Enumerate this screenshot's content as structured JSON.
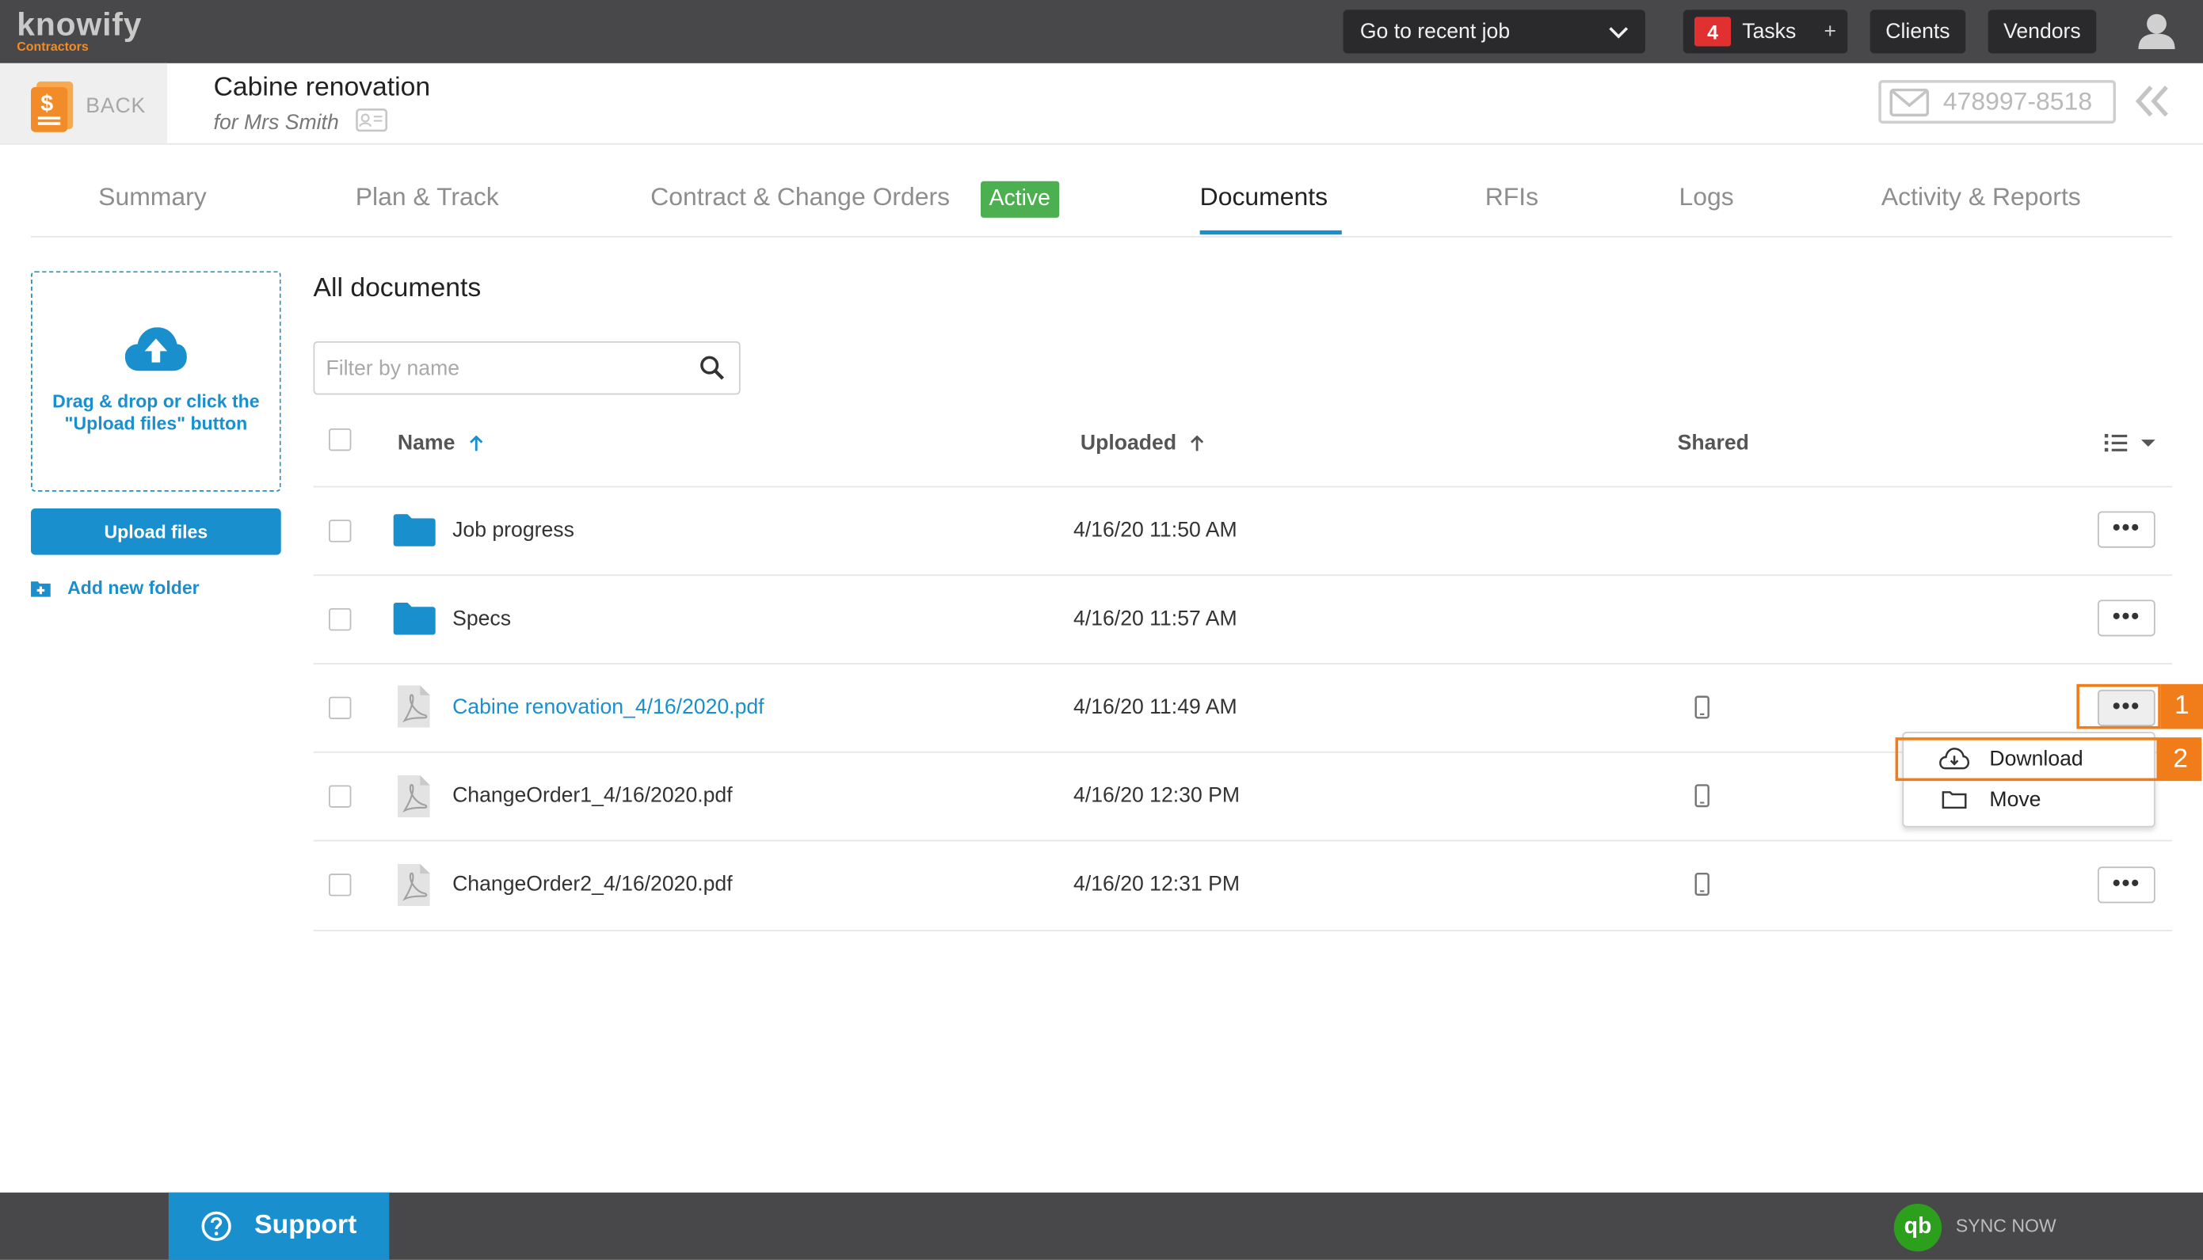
{
  "brand": {
    "name": "knowify",
    "sub": "Contractors"
  },
  "topbar": {
    "recent_job": "Go to recent job",
    "tasks_count": "4",
    "tasks_label": "Tasks",
    "tasks_plus": "+",
    "clients": "Clients",
    "vendors": "Vendors"
  },
  "job": {
    "back": "BACK",
    "title": "Cabine renovation",
    "subtitle": "for Mrs Smith",
    "phone": "478997-8518"
  },
  "tabs": [
    {
      "label": "Summary"
    },
    {
      "label": "Plan & Track"
    },
    {
      "label": "Contract & Change Orders",
      "badge": "Active"
    },
    {
      "label": "Documents"
    },
    {
      "label": "RFIs"
    },
    {
      "label": "Logs"
    },
    {
      "label": "Activity & Reports"
    }
  ],
  "sidebar": {
    "drop_text": "Drag & drop or click the \"Upload files\" button",
    "upload_button": "Upload files",
    "add_folder": "Add new folder"
  },
  "documents": {
    "title": "All documents",
    "filter_placeholder": "Filter by name",
    "columns": {
      "name": "Name",
      "uploaded": "Uploaded",
      "shared": "Shared"
    },
    "rows": [
      {
        "type": "folder",
        "name": "Job progress",
        "uploaded": "4/16/20 11:50 AM",
        "shared": false
      },
      {
        "type": "folder",
        "name": "Specs",
        "uploaded": "4/16/20 11:57 AM",
        "shared": false
      },
      {
        "type": "pdf",
        "name": "Cabine renovation_4/16/2020.pdf",
        "uploaded": "4/16/20 11:49 AM",
        "shared": true
      },
      {
        "type": "pdf",
        "name": "ChangeOrder1_4/16/2020.pdf",
        "uploaded": "4/16/20 12:30 PM",
        "shared": true
      },
      {
        "type": "pdf",
        "name": "ChangeOrder2_4/16/2020.pdf",
        "uploaded": "4/16/20 12:31 PM",
        "shared": true
      }
    ]
  },
  "row_menu": {
    "download": "Download",
    "move": "Move"
  },
  "annotations": {
    "step1": "1",
    "step2": "2"
  },
  "footer": {
    "support": "Support",
    "qb": "qb",
    "sync": "SYNC NOW"
  },
  "colors": {
    "accent": "#1a8fce",
    "highlight": "#f07c1a",
    "active_badge": "#4caf50",
    "topbar": "#48484a",
    "badge_red": "#e0302f"
  }
}
